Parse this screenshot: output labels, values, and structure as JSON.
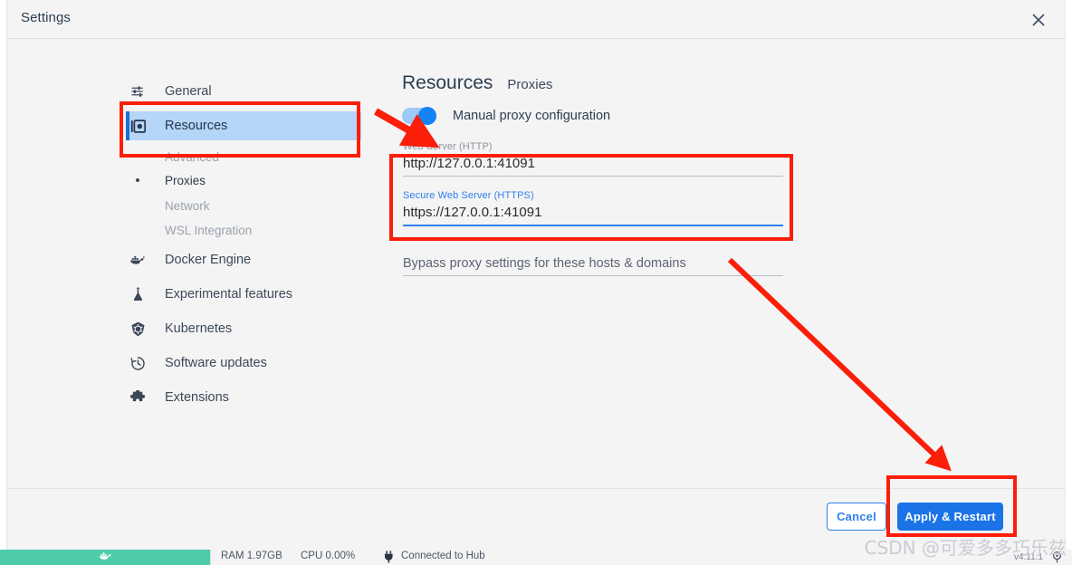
{
  "window": {
    "title": "Settings",
    "close_icon": "close-icon"
  },
  "sidebar": {
    "items": [
      {
        "label": "General",
        "icon": "sliders-icon",
        "selected": false
      },
      {
        "label": "Resources",
        "icon": "resources-icon",
        "selected": true
      },
      {
        "label": "Docker Engine",
        "icon": "docker-whale-icon",
        "selected": false
      },
      {
        "label": "Experimental features",
        "icon": "flask-icon",
        "selected": false
      },
      {
        "label": "Kubernetes",
        "icon": "kubernetes-icon",
        "selected": false
      },
      {
        "label": "Software updates",
        "icon": "history-clock-icon",
        "selected": false
      },
      {
        "label": "Extensions",
        "icon": "puzzle-piece-icon",
        "selected": false
      }
    ],
    "sub_items": [
      {
        "label": "Advanced",
        "active": false
      },
      {
        "label": "Proxies",
        "active": true
      },
      {
        "label": "Network",
        "active": false
      },
      {
        "label": "WSL Integration",
        "active": false
      }
    ]
  },
  "panel": {
    "heading": "Resources",
    "subheading": "Proxies",
    "toggle": {
      "label": "Manual proxy configuration",
      "state": "on"
    },
    "fields": [
      {
        "label": "Web Server (HTTP)",
        "value": "http://127.0.0.1:41091",
        "focused": false
      },
      {
        "label": "Secure Web Server (HTTPS)",
        "value": "https://127.0.0.1:41091",
        "focused": true
      },
      {
        "label": "",
        "value": "Bypass proxy settings for these hosts & domains",
        "focused": false
      }
    ]
  },
  "footer": {
    "cancel_label": "Cancel",
    "apply_label": "Apply & Restart"
  },
  "statusbar": {
    "ram": "RAM 1.97GB",
    "cpu": "CPU 0.00%",
    "connection": "Connected to Hub",
    "version": "v4.11.1",
    "whale_icon": "docker-whale-icon",
    "plug_icon": "plug-icon",
    "settings_icon": "gear-icon"
  },
  "watermark": "CSDN @可爱多多巧乐兹",
  "colors": {
    "annotation_red": "#fb1e08",
    "accent_blue": "#1a74e8",
    "selected_nav_bg": "#b5d6f8",
    "status_green": "#4ecca9",
    "focus_blue": "#2f80ed"
  }
}
